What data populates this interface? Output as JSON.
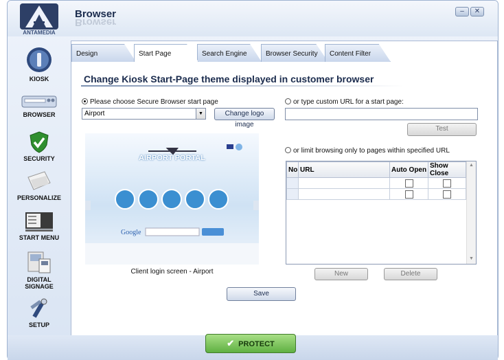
{
  "window": {
    "title": "Browser",
    "minimize_icon": "minimize-icon",
    "close_icon": "close-icon"
  },
  "logo": {
    "brand": "ANTAMEDIA"
  },
  "sidebar": {
    "items": [
      {
        "label": "KIOSK",
        "icon": "kiosk-icon"
      },
      {
        "label": "BROWSER",
        "icon": "browser-icon"
      },
      {
        "label": "SECURITY",
        "icon": "shield-check-icon"
      },
      {
        "label": "PERSONALIZE",
        "icon": "paper-icon"
      },
      {
        "label": "START MENU",
        "icon": "monitor-icon"
      },
      {
        "label": "DIGITAL",
        "label2": "SIGNAGE",
        "icon": "signage-icon"
      },
      {
        "label": "SETUP",
        "icon": "tools-icon"
      }
    ]
  },
  "tabs": [
    {
      "label": "Design"
    },
    {
      "label": "Start Page"
    },
    {
      "label": "Search Engine"
    },
    {
      "label": "Browser Security"
    },
    {
      "label": "Content Filter"
    }
  ],
  "main": {
    "heading": "Change Kiosk Start-Page theme displayed in customer browser",
    "option_choose": "Please choose Secure Browser start page",
    "theme_select": "Airport",
    "change_logo_button": "Change logo image",
    "option_custom": "or type custom URL for a start page:",
    "custom_url_value": "",
    "test_button": "Test",
    "option_limit": "or limit browsing only to pages within specified URL",
    "preview": {
      "portal_title": "AIRPORT PORTAL",
      "search_brand": "Google"
    },
    "preview_caption": "Client login screen - Airport",
    "grid": {
      "columns": [
        "No",
        "URL",
        "Auto Open",
        "Show Close"
      ]
    },
    "new_button": "New",
    "delete_button": "Delete",
    "save_button": "Save"
  },
  "footer": {
    "protect_button": "PROTECT"
  }
}
